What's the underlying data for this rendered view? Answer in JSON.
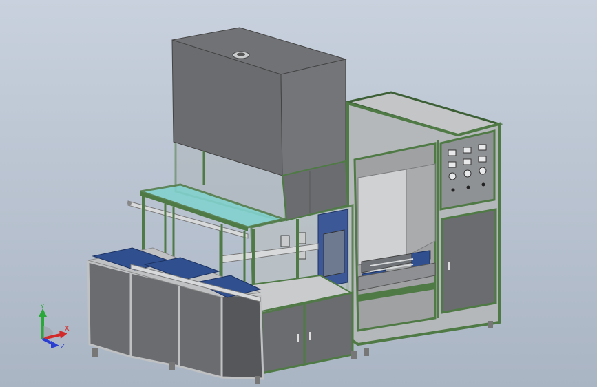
{
  "viewport": {
    "background_top": "#c8d1dd",
    "background_bottom": "#aab5c4"
  },
  "colors": {
    "frame_green": "#4f7a45",
    "frame_green_dark": "#3c5f36",
    "panel_gray": "#6a6c6f",
    "panel_gray_dark": "#55575a",
    "panel_gray_light": "#8a8c8f",
    "sheet_light": "#bfc1c3",
    "glass_cyan": "#7fd3cf",
    "part_blue": "#2f4f8f",
    "metal_light": "#d7d9db"
  },
  "triad": {
    "x_label": "X",
    "y_label": "Y",
    "z_label": "Z",
    "x_color": "#d22a2a",
    "y_color": "#2aa83a",
    "z_color": "#2a3fd2"
  }
}
